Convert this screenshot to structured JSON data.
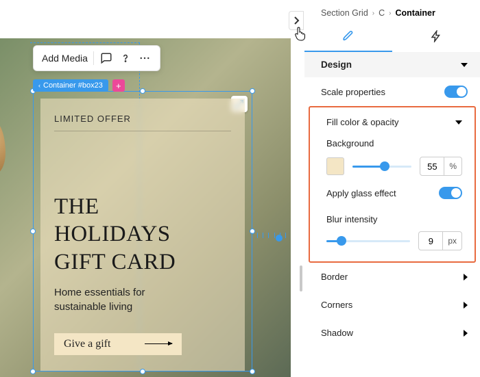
{
  "toolbar": {
    "add_media": "Add Media"
  },
  "selection": {
    "tag": "Container #box23"
  },
  "card": {
    "eyebrow": "LIMITED OFFER",
    "title_l1": "THE",
    "title_l2": "HOLIDAYS",
    "title_l3": "GIFT CARD",
    "sub_l1": "Home essentials for",
    "sub_l2": "sustainable living",
    "cta": "Give a gift"
  },
  "crumbs": {
    "a": "Section Grid",
    "b": "C",
    "c": "Container"
  },
  "panel": {
    "design": "Design",
    "scale_props": "Scale properties",
    "fill_opacity": "Fill color & opacity",
    "background": "Background",
    "opacity_value": "55",
    "opacity_unit": "%",
    "apply_glass": "Apply glass effect",
    "blur_intensity": "Blur intensity",
    "blur_value": "9",
    "blur_unit": "px",
    "border": "Border",
    "corners": "Corners",
    "shadow": "Shadow"
  },
  "colors": {
    "accent": "#3899ec",
    "swatch": "#f4e6c5",
    "callout": "#e86a3f"
  },
  "slider": {
    "opacity_fill_pct": 55,
    "blur_fill_pct": 18
  }
}
